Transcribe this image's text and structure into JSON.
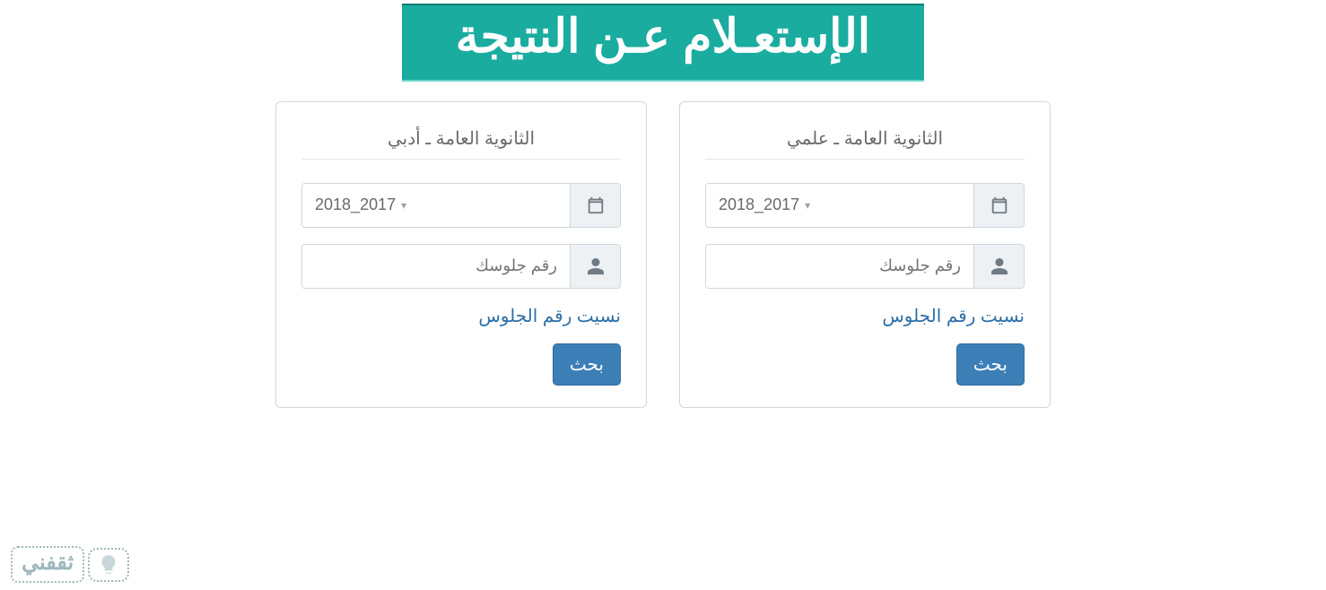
{
  "banner": {
    "title": "الإستعـلام عـن النتيجة"
  },
  "cards": [
    {
      "title": "الثانوية العامة ـ أدبي",
      "year": {
        "value": "2017_2018"
      },
      "seat": {
        "placeholder": "رقم جلوسك"
      },
      "forgot_label": "نسيت رقم الجلوس",
      "search_label": "بحث"
    },
    {
      "title": "الثانوية العامة ـ علمي",
      "year": {
        "value": "2017_2018"
      },
      "seat": {
        "placeholder": "رقم جلوسك"
      },
      "forgot_label": "نسيت رقم الجلوس",
      "search_label": "بحث"
    }
  ],
  "logo": {
    "text": "ثقفني"
  },
  "colors": {
    "accent": "#1baca0",
    "primary_btn": "#3c7fb7",
    "link": "#2c6fa8"
  }
}
